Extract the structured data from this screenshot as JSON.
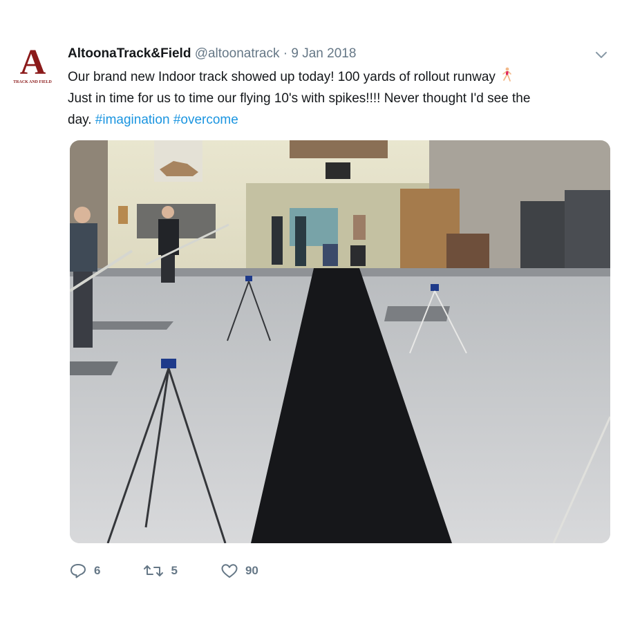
{
  "avatar": {
    "letter": "A",
    "subtitle": "TRACK AND FIELD"
  },
  "tweet": {
    "name": "AltoonaTrack&Field",
    "handle": "@altoonatrack",
    "separator": "·",
    "date": "9 Jan 2018",
    "text_line1": "Our brand new Indoor track showed up today! 100 yards of rollout runway",
    "text_line2": "Just in time for us to time our flying 10's with spikes!!!! Never thought I'd see the",
    "text_line3": "day.",
    "hashtags": [
      "#imagination",
      "#overcome"
    ]
  },
  "actions": {
    "reply_count": "6",
    "retweet_count": "5",
    "like_count": "90"
  },
  "icons": {
    "avatar": "altoona-a-logo",
    "runner": "woman-running-icon",
    "caret": "chevron-down-icon",
    "reply": "reply-icon",
    "retweet": "retweet-icon",
    "like": "heart-icon"
  },
  "colors": {
    "brand_red": "#8b1a1a",
    "link_blue": "#1b95e0",
    "secondary_gray": "#657786",
    "text_dark": "#14171a"
  }
}
